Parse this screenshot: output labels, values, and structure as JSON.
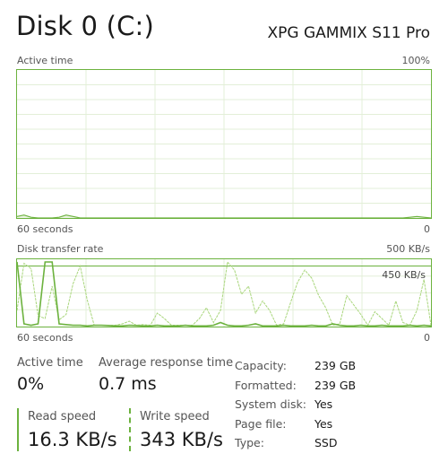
{
  "header": {
    "title": "Disk 0 (C:)",
    "model": "XPG GAMMIX S11 Pro"
  },
  "active_time_graph": {
    "label": "Active time",
    "max_label": "100%",
    "x_left_label": "60 seconds",
    "x_right_label": "0",
    "line_color": "#6cb23e",
    "grid_color": "#e3efd8",
    "values_percent": [
      1,
      2,
      0.5,
      0,
      0,
      0,
      0.5,
      2,
      1,
      0,
      0,
      0,
      0,
      0,
      0,
      0,
      0,
      0,
      0,
      0,
      0,
      0,
      0,
      0,
      0,
      0,
      0,
      0,
      0,
      0,
      0,
      0,
      0,
      0,
      0,
      0,
      0,
      0,
      0,
      0,
      0,
      0,
      0,
      0,
      0,
      0,
      0,
      0,
      0,
      0,
      0,
      0,
      0,
      0,
      0,
      0,
      0.5,
      1,
      0.5,
      0
    ]
  },
  "transfer_graph": {
    "label": "Disk transfer rate",
    "max_label": "500 KB/s",
    "line_label": "450 KB/s",
    "x_left_label": "60 seconds",
    "x_right_label": "0",
    "scale_max_kbs": 500,
    "reference_line_kbs": 450,
    "line_color": "#6cb23e",
    "read_series_kbs": [
      480,
      20,
      10,
      20,
      480,
      480,
      20,
      15,
      10,
      10,
      5,
      10,
      10,
      8,
      5,
      5,
      10,
      8,
      5,
      5,
      10,
      5,
      5,
      5,
      10,
      5,
      5,
      5,
      10,
      30,
      10,
      5,
      5,
      10,
      20,
      5,
      5,
      5,
      10,
      5,
      5,
      5,
      10,
      5,
      5,
      20,
      10,
      5,
      5,
      10,
      5,
      5,
      10,
      5,
      5,
      5,
      10,
      5,
      10,
      5
    ],
    "write_series_kbs": [
      120,
      470,
      430,
      80,
      60,
      300,
      50,
      90,
      320,
      450,
      200,
      10,
      10,
      10,
      10,
      20,
      40,
      10,
      15,
      10,
      100,
      60,
      10,
      10,
      10,
      10,
      60,
      140,
      30,
      120,
      480,
      420,
      240,
      300,
      100,
      190,
      120,
      10,
      20,
      180,
      330,
      420,
      360,
      230,
      140,
      10,
      20,
      230,
      160,
      90,
      10,
      110,
      60,
      10,
      190,
      30,
      10,
      120,
      350,
      10
    ]
  },
  "stats": {
    "active_time": {
      "label": "Active time",
      "value": "0%"
    },
    "avg_response": {
      "label": "Average response time",
      "value": "0.7 ms"
    },
    "read_speed": {
      "label": "Read speed",
      "value": "16.3 KB/s"
    },
    "write_speed": {
      "label": "Write speed",
      "value": "343 KB/s"
    }
  },
  "properties": [
    {
      "key": "Capacity:",
      "value": "239 GB"
    },
    {
      "key": "Formatted:",
      "value": "239 GB"
    },
    {
      "key": "System disk:",
      "value": "Yes"
    },
    {
      "key": "Page file:",
      "value": "Yes"
    },
    {
      "key": "Type:",
      "value": "SSD"
    }
  ]
}
